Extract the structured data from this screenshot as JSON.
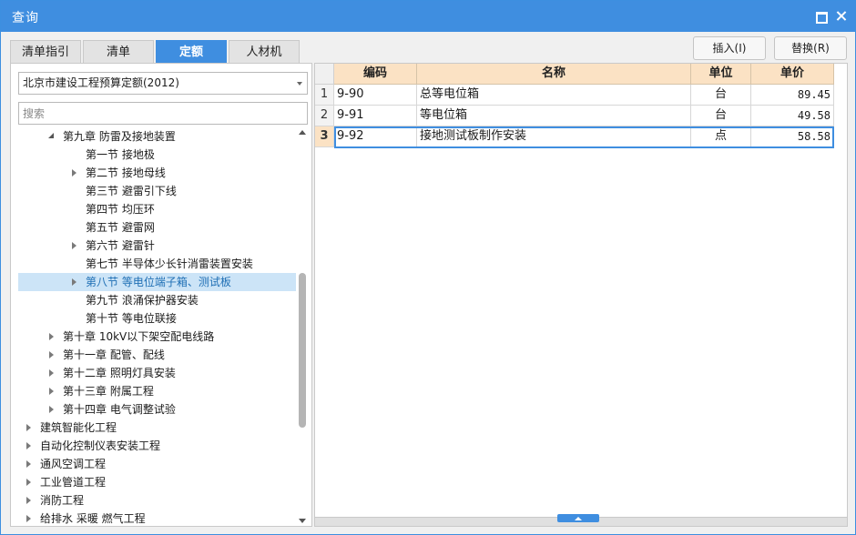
{
  "window": {
    "title": "查询"
  },
  "tabs": [
    {
      "label": "清单指引",
      "active": false
    },
    {
      "label": "清单",
      "active": false
    },
    {
      "label": "定额",
      "active": true
    },
    {
      "label": "人材机",
      "active": false
    }
  ],
  "actions": {
    "insert_label": "插入(I)",
    "replace_label": "替换(R)"
  },
  "left": {
    "selected_library": "北京市建设工程预算定额(2012)",
    "search_placeholder": "搜索",
    "tree": [
      {
        "label": "第九章 防雷及接地装置",
        "level": 1,
        "toggle": "expanded",
        "selected": false
      },
      {
        "label": "第一节 接地极",
        "level": 2,
        "toggle": "none",
        "selected": false
      },
      {
        "label": "第二节 接地母线",
        "level": 2,
        "toggle": "collapsed",
        "selected": false
      },
      {
        "label": "第三节 避雷引下线",
        "level": 2,
        "toggle": "none",
        "selected": false
      },
      {
        "label": "第四节 均压环",
        "level": 2,
        "toggle": "none",
        "selected": false
      },
      {
        "label": "第五节 避雷网",
        "level": 2,
        "toggle": "none",
        "selected": false
      },
      {
        "label": "第六节 避雷针",
        "level": 2,
        "toggle": "collapsed",
        "selected": false
      },
      {
        "label": "第七节 半导体少长针消雷装置安装",
        "level": 2,
        "toggle": "none",
        "selected": false
      },
      {
        "label": "第八节 等电位端子箱、测试板",
        "level": 2,
        "toggle": "collapsed",
        "selected": true
      },
      {
        "label": "第九节 浪涌保护器安装",
        "level": 2,
        "toggle": "none",
        "selected": false
      },
      {
        "label": "第十节 等电位联接",
        "level": 2,
        "toggle": "none",
        "selected": false
      },
      {
        "label": "第十章 10kV以下架空配电线路",
        "level": 1,
        "toggle": "collapsed",
        "selected": false
      },
      {
        "label": "第十一章 配管、配线",
        "level": 1,
        "toggle": "collapsed",
        "selected": false
      },
      {
        "label": "第十二章 照明灯具安装",
        "level": 1,
        "toggle": "collapsed",
        "selected": false
      },
      {
        "label": "第十三章 附属工程",
        "level": 1,
        "toggle": "collapsed",
        "selected": false
      },
      {
        "label": "第十四章 电气调整试验",
        "level": 1,
        "toggle": "collapsed",
        "selected": false
      },
      {
        "label": "建筑智能化工程",
        "level": 0,
        "toggle": "collapsed",
        "selected": false
      },
      {
        "label": "自动化控制仪表安装工程",
        "level": 0,
        "toggle": "collapsed",
        "selected": false
      },
      {
        "label": "通风空调工程",
        "level": 0,
        "toggle": "collapsed",
        "selected": false
      },
      {
        "label": "工业管道工程",
        "level": 0,
        "toggle": "collapsed",
        "selected": false
      },
      {
        "label": "消防工程",
        "level": 0,
        "toggle": "collapsed",
        "selected": false
      },
      {
        "label": "给排水 采暖 燃气工程",
        "level": 0,
        "toggle": "collapsed",
        "selected": false
      }
    ]
  },
  "grid": {
    "columns": [
      "编码",
      "名称",
      "单位",
      "单价"
    ],
    "rows": [
      {
        "num": "1",
        "code": "9-90",
        "name": "总等电位箱",
        "unit": "台",
        "price": "89.45"
      },
      {
        "num": "2",
        "code": "9-91",
        "name": "等电位箱",
        "unit": "台",
        "price": "49.58"
      },
      {
        "num": "3",
        "code": "9-92",
        "name": "接地测试板制作安装",
        "unit": "点",
        "price": "58.58"
      }
    ],
    "current_row": 3
  }
}
